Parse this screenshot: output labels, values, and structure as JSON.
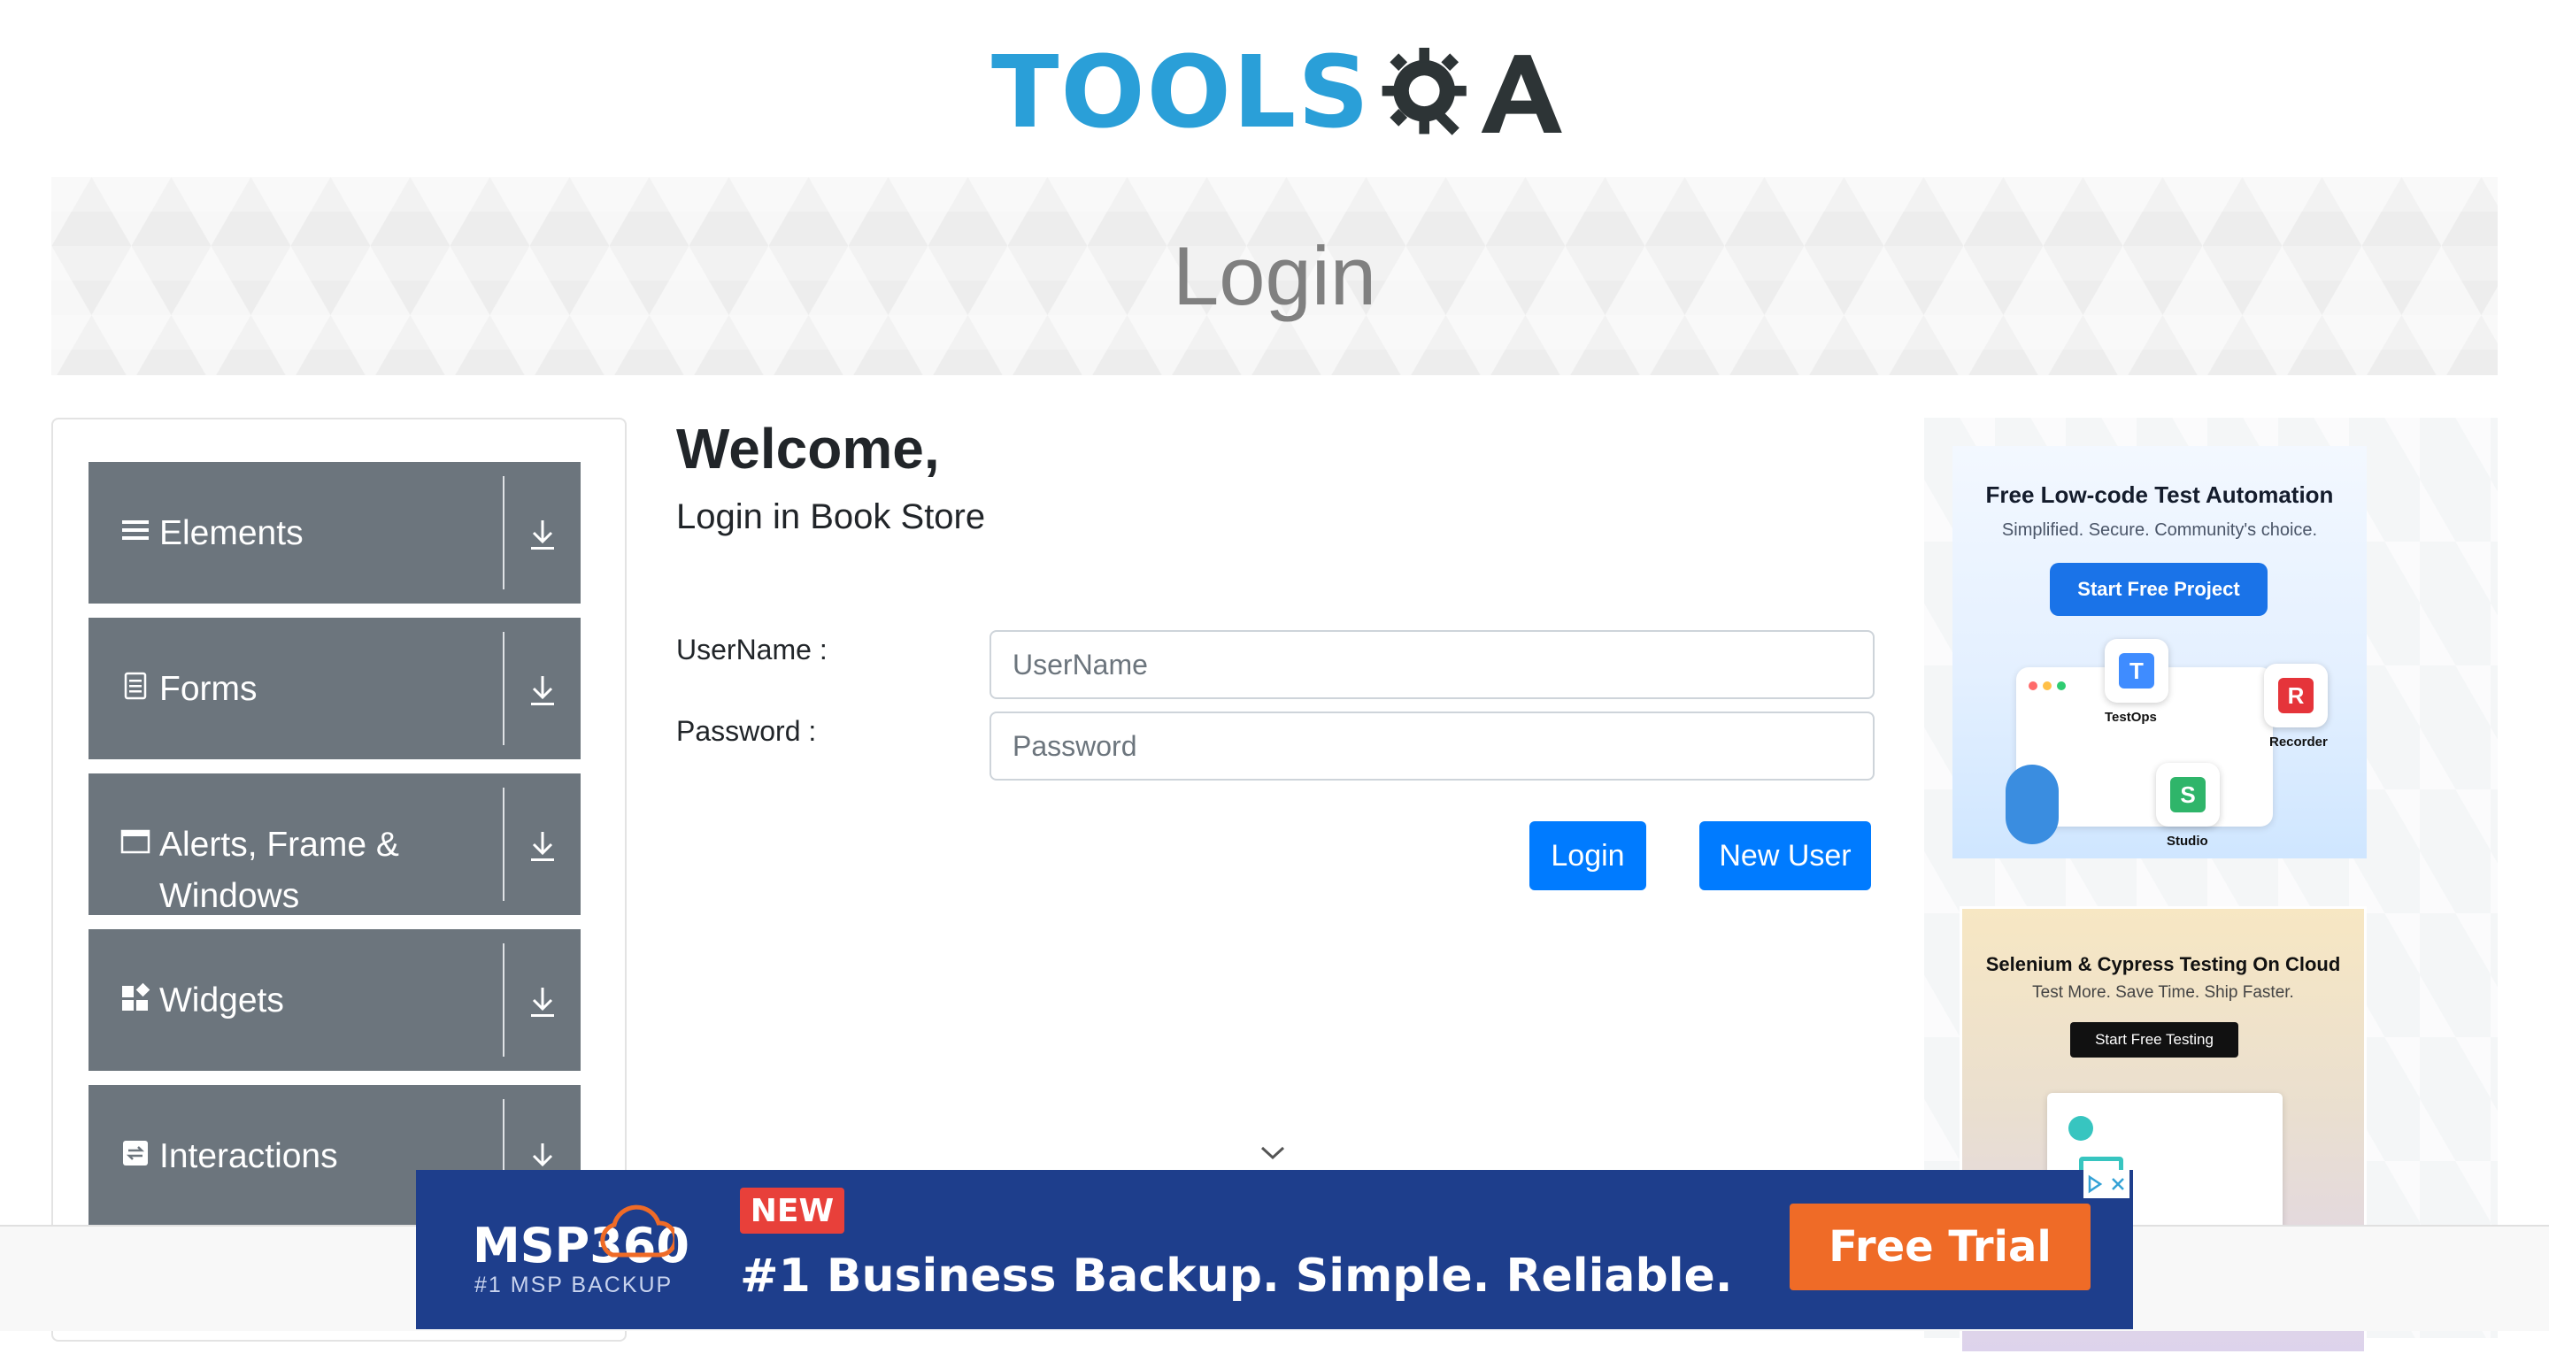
{
  "logo": {
    "text_tools": "TOOLS",
    "text_qa": "QA"
  },
  "banner": {
    "title": "Login"
  },
  "sidebar": {
    "items": [
      {
        "label": "Elements",
        "icon": "hamburger-icon"
      },
      {
        "label": "Forms",
        "icon": "document-icon"
      },
      {
        "label": "Alerts, Frame & Windows",
        "icon": "window-icon"
      },
      {
        "label": "Widgets",
        "icon": "widgets-icon"
      },
      {
        "label": "Interactions",
        "icon": "interactions-icon"
      }
    ]
  },
  "main": {
    "welcome": "Welcome,",
    "subtitle": "Login in Book Store",
    "username_label": "UserName :",
    "username_placeholder": "UserName",
    "password_label": "Password :",
    "password_placeholder": "Password",
    "login_button": "Login",
    "new_user_button": "New User"
  },
  "ads": {
    "katalon": {
      "title": "Free Low-code Test Automation",
      "subtitle": "Simplified. Secure. Community's choice.",
      "cta": "Start Free Project",
      "testops": "TestOps",
      "recorder": "Recorder",
      "studio": "Studio"
    },
    "lambdatest": {
      "title": "Selenium & Cypress Testing On Cloud",
      "subtitle": "Test More. Save Time. Ship Faster.",
      "cta": "Start Free Testing"
    },
    "msp": {
      "brand": "MSP360",
      "tagline": "#1 MSP BACKUP",
      "badge": "NEW",
      "headline": "#1 Business Backup. Simple. Reliable.",
      "cta": "Free Trial"
    }
  },
  "colors": {
    "primary": "#007bff",
    "menu_bg": "#6c757d",
    "logo_blue": "#2a9fd8",
    "ad_navy": "#1e3e8c",
    "ad_orange": "#ef6b27"
  }
}
